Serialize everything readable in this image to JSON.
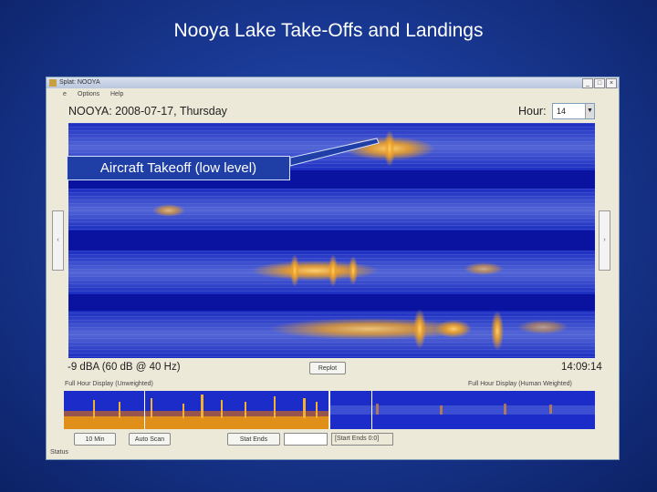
{
  "slide": {
    "title": "Nooya Lake Take-Offs and Landings"
  },
  "window": {
    "title": "Splat: NOOYA",
    "menu": [
      "e",
      "Options",
      "Help"
    ],
    "buttons": {
      "minimize": "_",
      "maximize": "□",
      "close": "×"
    }
  },
  "header": {
    "station_date": "NOOYA: 2008-07-17, Thursday",
    "hour_label": "Hour:",
    "hour_value": "14"
  },
  "spectrogram": {
    "callout": "Aircraft Takeoff (low level)",
    "colors": {
      "low": "#1c2fc8",
      "mid": "#5a6cd8",
      "high": "#f0a020",
      "peak": "#ffd070"
    }
  },
  "readout": {
    "level": "-9 dBA (60 dB @    40 Hz)",
    "time": "14:09:14",
    "replot_button": "Replot"
  },
  "panels": {
    "left_label": "Full Hour Display (Unweighted)",
    "right_label": "Full Hour Display (Human Weighted)"
  },
  "toolbar": {
    "b1": "10 Min",
    "b2": "Auto Scan",
    "b3": "Stat Ends",
    "field1": "",
    "field2": "[Start Ends 0:0]"
  },
  "statusbar": {
    "text": "Status"
  }
}
